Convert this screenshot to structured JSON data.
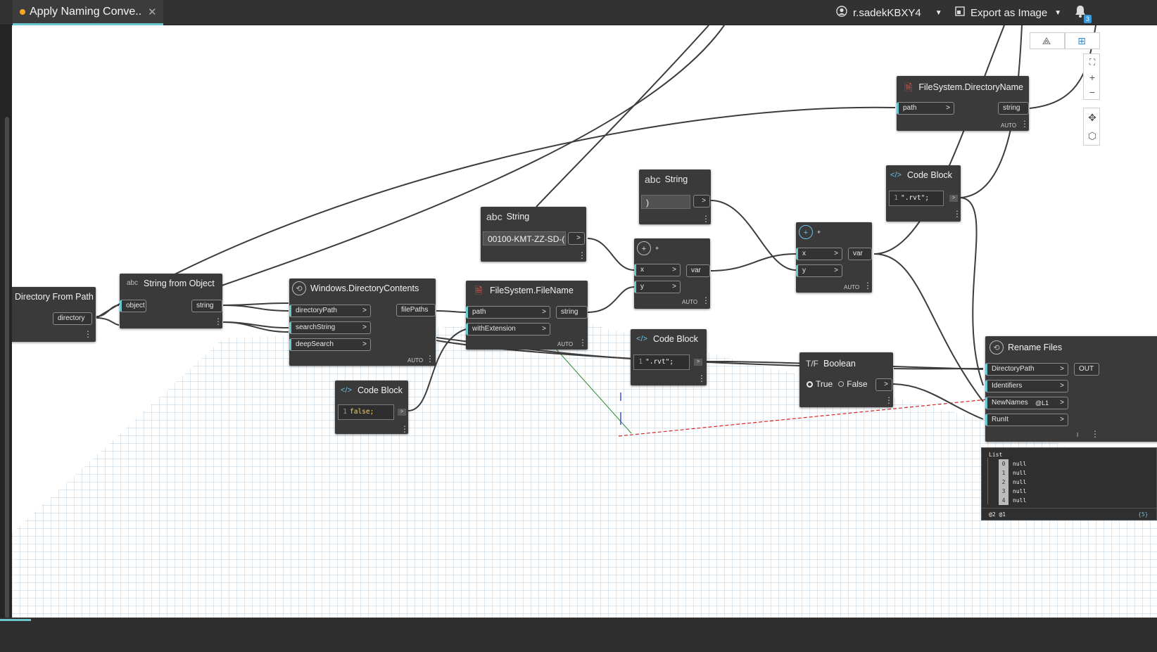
{
  "tab": {
    "title": "Apply Naming Conve...",
    "close": "✕",
    "modified": true
  },
  "header": {
    "user_name": "r.sadekKBXY4",
    "export_label": "Export as Image",
    "notification_count": "3"
  },
  "nodes": {
    "dir_from_path": {
      "title": "Directory From Path",
      "out": "directory"
    },
    "string_from_object": {
      "title": "String from Object",
      "in": "object",
      "out": "string"
    },
    "dir_contents": {
      "title": "Windows.DirectoryContents",
      "inputs": [
        "directoryPath",
        "searchString",
        "deepSearch"
      ],
      "out": "filePaths",
      "lacing": "AUTO"
    },
    "code_block_false": {
      "title": "Code Block",
      "line": "1",
      "code": "false;"
    },
    "string_prefix": {
      "title": "String",
      "value": "00100-KMT-ZZ-SD-("
    },
    "file_name": {
      "title": "FileSystem.FileName",
      "inputs": [
        "path",
        "withExtension"
      ],
      "out": "string",
      "lacing": "AUTO"
    },
    "string_paren": {
      "title": "String",
      "value": ")"
    },
    "plus_1": {
      "title": "+",
      "inputs": [
        "x",
        "y"
      ],
      "out": "var",
      "lacing": "AUTO"
    },
    "code_block_rvt_1": {
      "title": "Code Block",
      "line": "1",
      "code": "\".rvt\";"
    },
    "plus_2": {
      "title": "+",
      "inputs": [
        "x",
        "y"
      ],
      "out": "var",
      "lacing": "AUTO"
    },
    "boolean": {
      "title": "Boolean",
      "true_label": "True",
      "false_label": "False"
    },
    "code_block_rvt_2": {
      "title": "Code Block",
      "line": "1",
      "code": "\".rvt\";"
    },
    "dir_name": {
      "title": "FileSystem.DirectoryName",
      "in": "path",
      "out": "string",
      "lacing": "AUTO"
    },
    "rename_files": {
      "title": "Rename Files",
      "inputs": [
        "DirectoryPath",
        "Identifiers",
        "NewNames",
        "RunIt"
      ],
      "out": "OUT",
      "level": "@L1",
      "lacing": "I"
    }
  },
  "preview": {
    "header": "List",
    "items": [
      {
        "index": "0",
        "value": "null"
      },
      {
        "index": "1",
        "value": "null"
      },
      {
        "index": "2",
        "value": "null"
      },
      {
        "index": "3",
        "value": "null"
      },
      {
        "index": "4",
        "value": "null"
      }
    ],
    "levels": "@2 @1",
    "count": "{5}"
  },
  "icons": [
    "user-icon",
    "chevron-down-icon",
    "export-image-icon",
    "bell-icon",
    "fit-view-icon",
    "zoom-in-icon",
    "zoom-out-icon",
    "pan-icon",
    "orbit-icon"
  ]
}
